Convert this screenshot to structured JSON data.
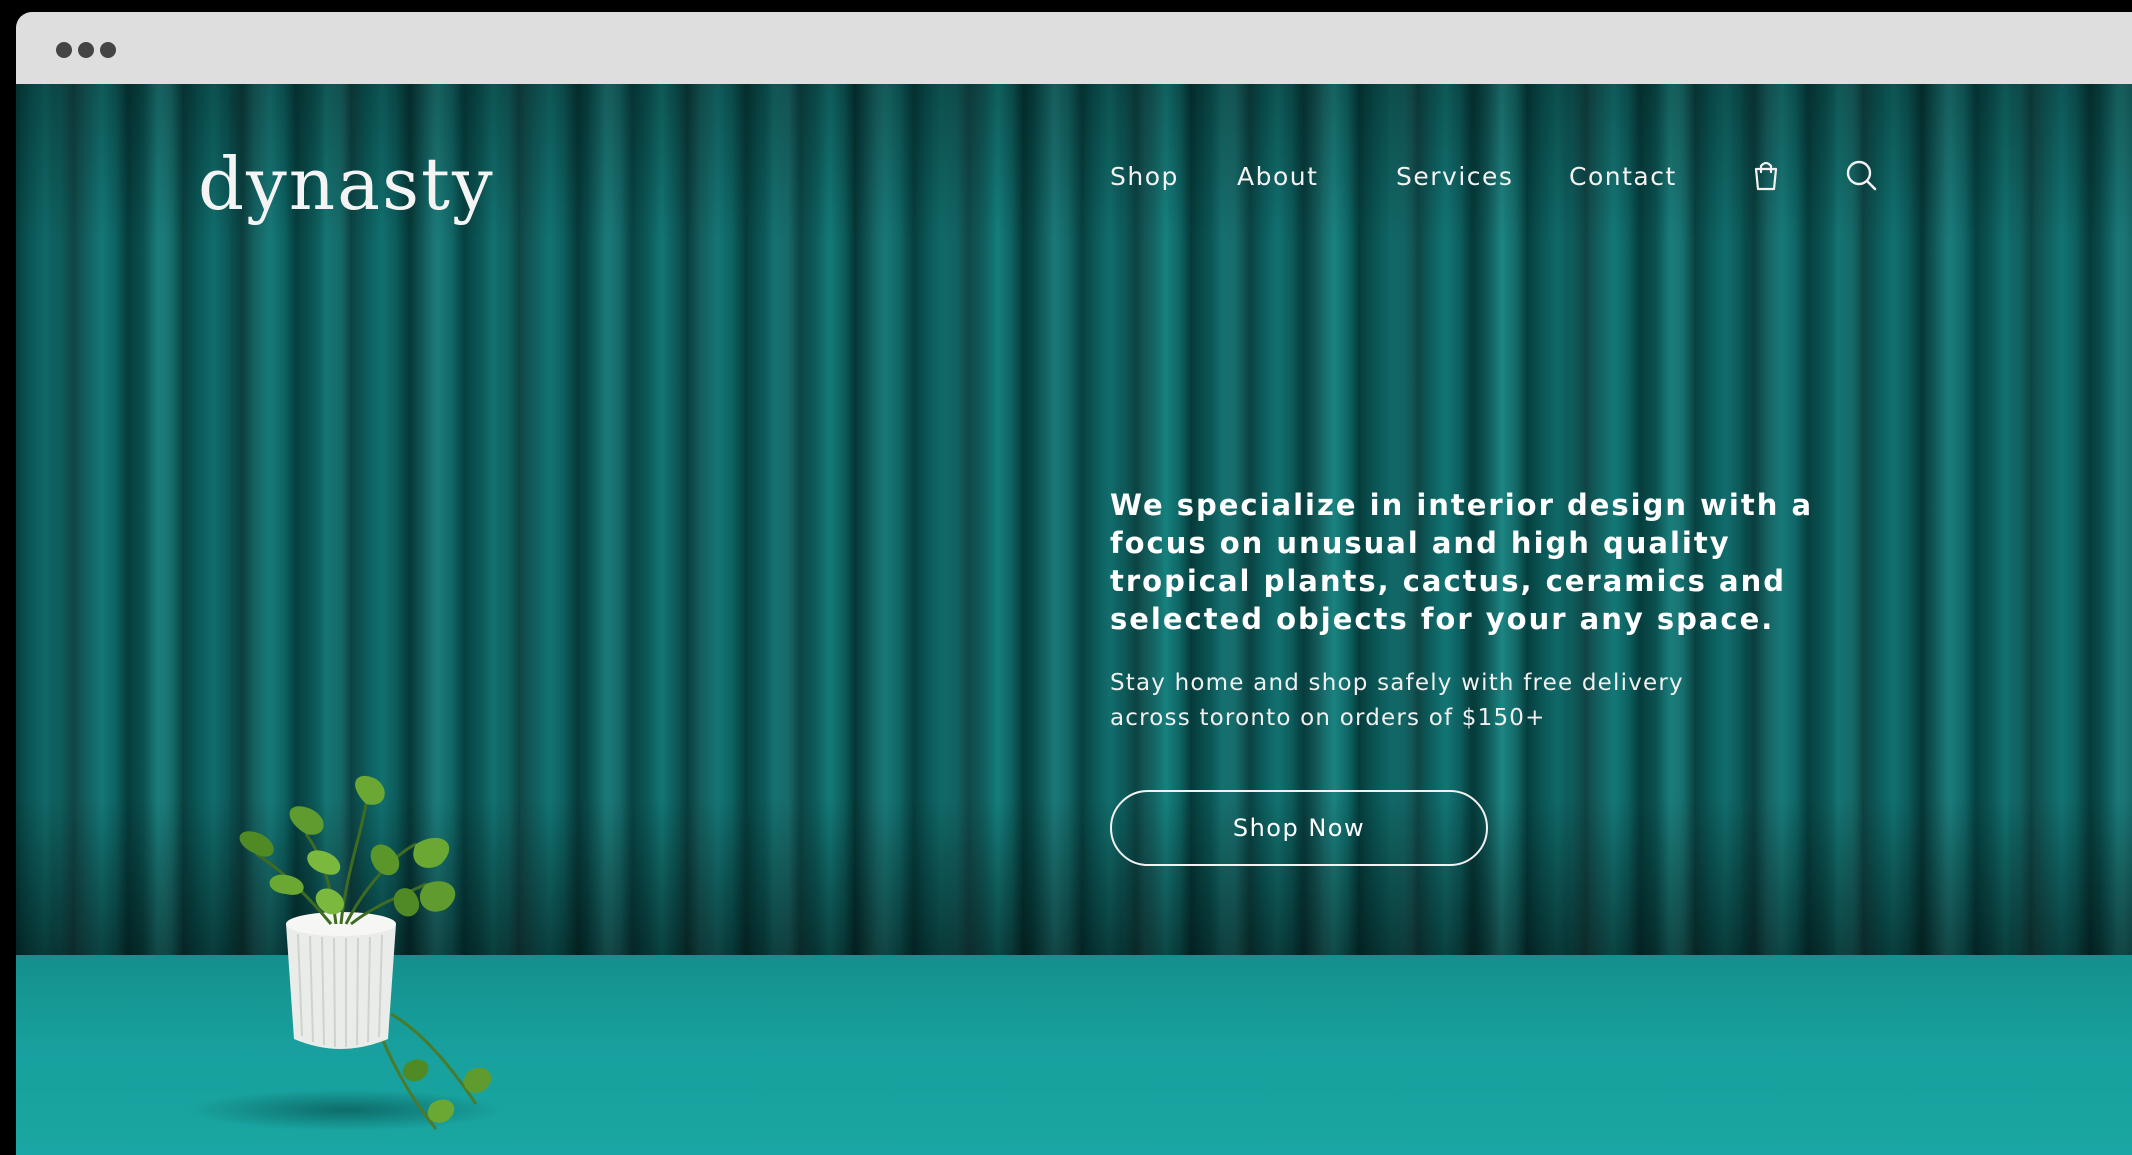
{
  "browser": {
    "window_controls": [
      "dot-1",
      "dot-2",
      "dot-3"
    ]
  },
  "brand": {
    "logo_text": "dynasty"
  },
  "nav": {
    "items": [
      {
        "label": "Shop"
      },
      {
        "label": "About"
      },
      {
        "label": "Services"
      },
      {
        "label": "Contact"
      }
    ],
    "icons": [
      "shopping-bag-icon",
      "search-icon"
    ]
  },
  "hero": {
    "headline": "We specialize in interior design with a focus on unusual and high quality tropical plants, cactus, ceramics and selected objects for your any space.",
    "subline": "Stay home and shop safely with free delivery across toronto on orders of $150+",
    "cta_label": "Shop Now"
  },
  "colors": {
    "curtain": "#0c5b5b",
    "floor": "#17a09d",
    "titlebar": "#dedede",
    "text": "#ffffff"
  }
}
